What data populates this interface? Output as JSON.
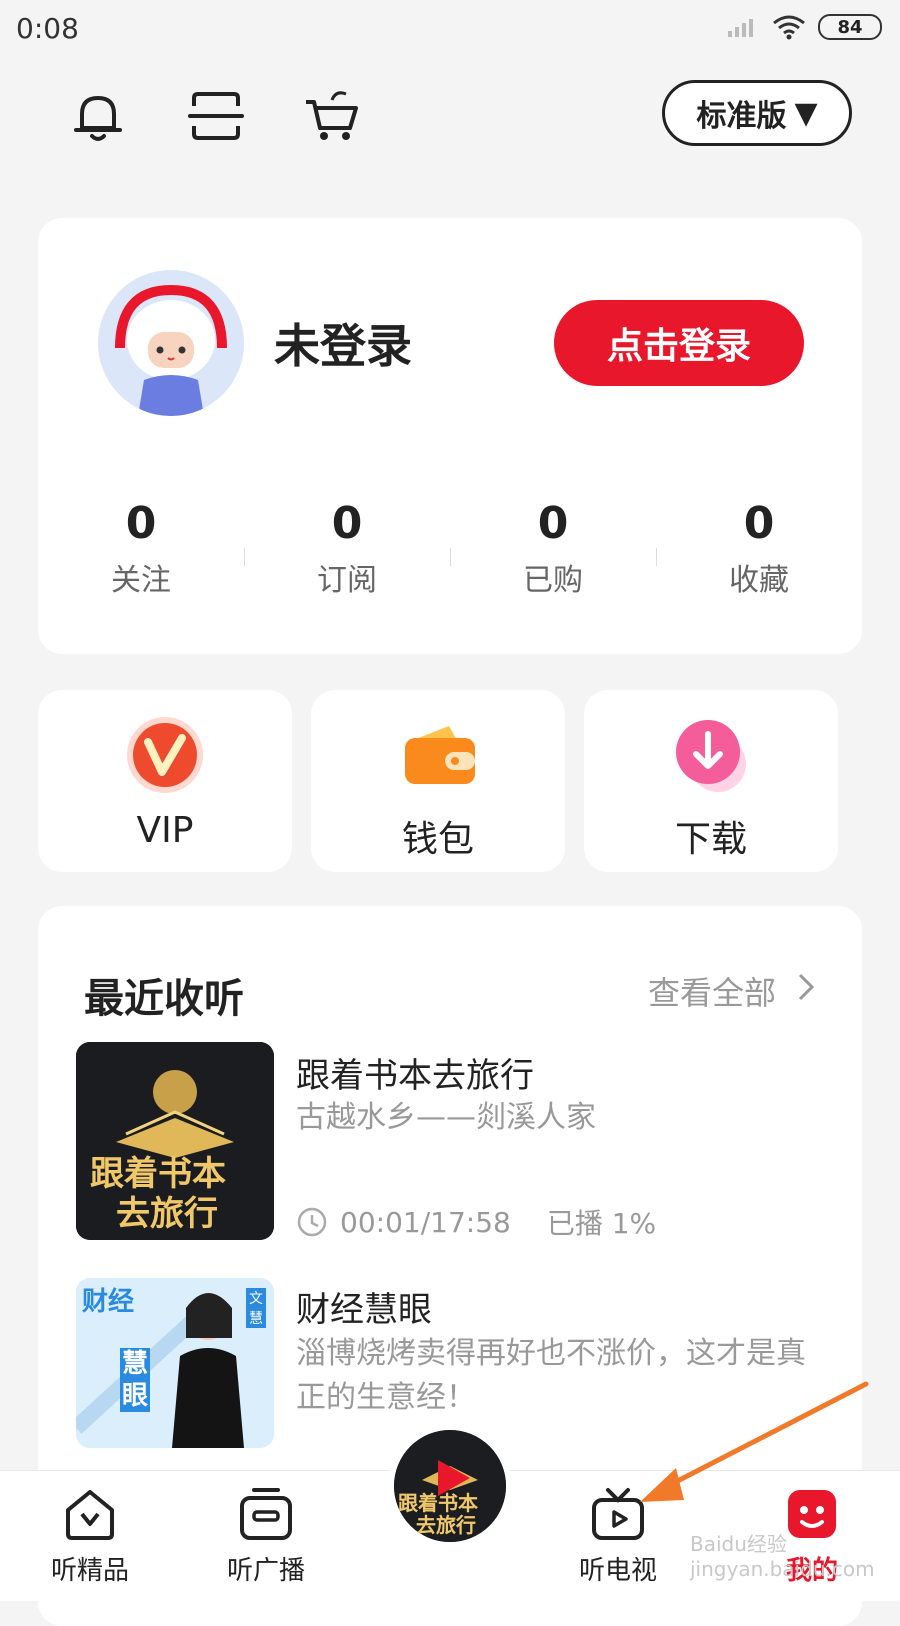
{
  "status_bar": {
    "time": "0:08",
    "battery": "84"
  },
  "toolbar": {
    "icons": [
      "bell-icon",
      "scan-icon",
      "shopping-cart-icon"
    ],
    "edition_label": "标准版"
  },
  "profile": {
    "username": "未登录",
    "login_button": "点击登录",
    "stats": [
      {
        "value": "0",
        "label": "关注"
      },
      {
        "value": "0",
        "label": "订阅"
      },
      {
        "value": "0",
        "label": "已购"
      },
      {
        "value": "0",
        "label": "收藏"
      }
    ]
  },
  "quick_tiles": [
    {
      "label": "VIP",
      "icon": "vip-icon"
    },
    {
      "label": "钱包",
      "icon": "wallet-icon"
    },
    {
      "label": "下载",
      "icon": "download-icon"
    }
  ],
  "recent": {
    "title": "最近收听",
    "view_all": "查看全部",
    "items": [
      {
        "title": "跟着书本去旅行",
        "subtitle": "古越水乡——剡溪人家",
        "progress_time": "00:01/17:58",
        "progress_text": "已播 1%",
        "cover_text_line1": "跟着书本",
        "cover_text_line2": "去旅行"
      },
      {
        "title": "财经慧眼",
        "subtitle": "淄博烧烤卖得再好也不涨价，这才是真正的生意经！",
        "cover_text_a": "财经",
        "cover_text_b": "慧眼",
        "cover_tag": "文慧"
      }
    ]
  },
  "tab_bar": {
    "tabs": [
      {
        "label": "听精品",
        "icon": "home-icon"
      },
      {
        "label": "听广播",
        "icon": "radio-icon"
      },
      {
        "label": "听电视",
        "icon": "tv-icon"
      },
      {
        "label": "我的",
        "icon": "me-icon"
      }
    ],
    "center_disc_line1": "跟着书本",
    "center_disc_line2": "去旅行"
  },
  "watermark": "Baidu经验 jingyan.baidu.com",
  "colors": {
    "accent_red": "#e8172c",
    "annotation_arrow": "#f07a2a"
  }
}
